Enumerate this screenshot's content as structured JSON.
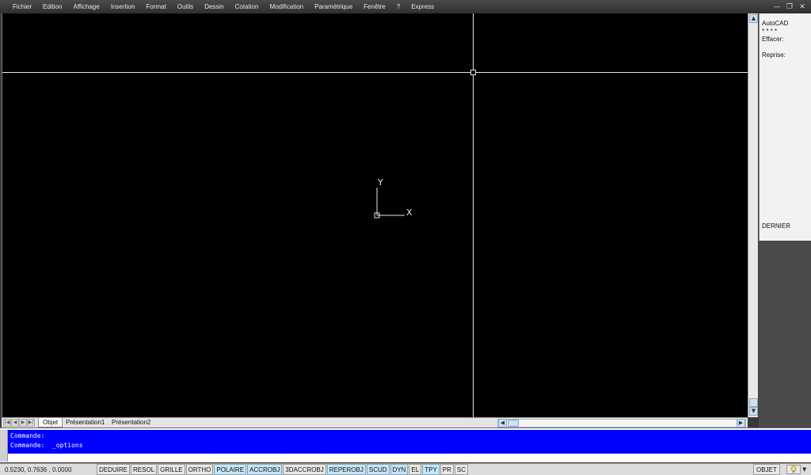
{
  "menu": [
    "Fichier",
    "Edition",
    "Affichage",
    "Insertion",
    "Format",
    "Outils",
    "Dessin",
    "Cotation",
    "Modification",
    "Paramétrique",
    "Fenêtre",
    "?",
    "Express"
  ],
  "window_controls": {
    "minimize": "—",
    "restore": "❐",
    "close": "✕"
  },
  "ucs": {
    "x_label": "X",
    "y_label": "Y"
  },
  "properties_panel": {
    "lines": [
      "AutoCAD",
      "* * * *",
      "Effacer:",
      "",
      "Reprise:"
    ],
    "bottom_label": "DERNIER"
  },
  "layout_tabs": [
    "Objet",
    "Présentation1",
    "Présentation2"
  ],
  "command": {
    "history": [
      "Commande:",
      "Commande:  _options"
    ],
    "input_value": ""
  },
  "status": {
    "coordinates": "0.5230, 0.7636 , 0.0000",
    "toggles": [
      {
        "label": "DEDUIRE",
        "on": false
      },
      {
        "label": "RESOL",
        "on": false
      },
      {
        "label": "GRILLE",
        "on": false
      },
      {
        "label": "ORTHO",
        "on": false
      },
      {
        "label": "POLAIRE",
        "on": true
      },
      {
        "label": "ACCROBJ",
        "on": true
      },
      {
        "label": "3DACCROBJ",
        "on": false
      },
      {
        "label": "REPEROBJ",
        "on": true
      },
      {
        "label": "SCUD",
        "on": true
      },
      {
        "label": "DYN",
        "on": true
      },
      {
        "label": "EL",
        "on": false
      },
      {
        "label": "TPY",
        "on": true
      },
      {
        "label": "PR",
        "on": false
      },
      {
        "label": "SC",
        "on": false
      }
    ],
    "space_label": "OBJET"
  },
  "colors": {
    "canvas": "#000000",
    "command_bg": "#0000ff",
    "toggle_on": "#c8e6f5"
  }
}
